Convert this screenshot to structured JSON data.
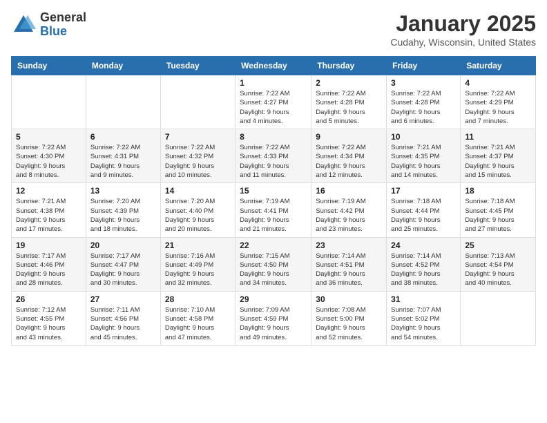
{
  "logo": {
    "general": "General",
    "blue": "Blue"
  },
  "title": "January 2025",
  "location": "Cudahy, Wisconsin, United States",
  "headers": [
    "Sunday",
    "Monday",
    "Tuesday",
    "Wednesday",
    "Thursday",
    "Friday",
    "Saturday"
  ],
  "weeks": [
    [
      {
        "day": "",
        "info": ""
      },
      {
        "day": "",
        "info": ""
      },
      {
        "day": "",
        "info": ""
      },
      {
        "day": "1",
        "info": "Sunrise: 7:22 AM\nSunset: 4:27 PM\nDaylight: 9 hours\nand 4 minutes."
      },
      {
        "day": "2",
        "info": "Sunrise: 7:22 AM\nSunset: 4:28 PM\nDaylight: 9 hours\nand 5 minutes."
      },
      {
        "day": "3",
        "info": "Sunrise: 7:22 AM\nSunset: 4:28 PM\nDaylight: 9 hours\nand 6 minutes."
      },
      {
        "day": "4",
        "info": "Sunrise: 7:22 AM\nSunset: 4:29 PM\nDaylight: 9 hours\nand 7 minutes."
      }
    ],
    [
      {
        "day": "5",
        "info": "Sunrise: 7:22 AM\nSunset: 4:30 PM\nDaylight: 9 hours\nand 8 minutes."
      },
      {
        "day": "6",
        "info": "Sunrise: 7:22 AM\nSunset: 4:31 PM\nDaylight: 9 hours\nand 9 minutes."
      },
      {
        "day": "7",
        "info": "Sunrise: 7:22 AM\nSunset: 4:32 PM\nDaylight: 9 hours\nand 10 minutes."
      },
      {
        "day": "8",
        "info": "Sunrise: 7:22 AM\nSunset: 4:33 PM\nDaylight: 9 hours\nand 11 minutes."
      },
      {
        "day": "9",
        "info": "Sunrise: 7:22 AM\nSunset: 4:34 PM\nDaylight: 9 hours\nand 12 minutes."
      },
      {
        "day": "10",
        "info": "Sunrise: 7:21 AM\nSunset: 4:35 PM\nDaylight: 9 hours\nand 14 minutes."
      },
      {
        "day": "11",
        "info": "Sunrise: 7:21 AM\nSunset: 4:37 PM\nDaylight: 9 hours\nand 15 minutes."
      }
    ],
    [
      {
        "day": "12",
        "info": "Sunrise: 7:21 AM\nSunset: 4:38 PM\nDaylight: 9 hours\nand 17 minutes."
      },
      {
        "day": "13",
        "info": "Sunrise: 7:20 AM\nSunset: 4:39 PM\nDaylight: 9 hours\nand 18 minutes."
      },
      {
        "day": "14",
        "info": "Sunrise: 7:20 AM\nSunset: 4:40 PM\nDaylight: 9 hours\nand 20 minutes."
      },
      {
        "day": "15",
        "info": "Sunrise: 7:19 AM\nSunset: 4:41 PM\nDaylight: 9 hours\nand 21 minutes."
      },
      {
        "day": "16",
        "info": "Sunrise: 7:19 AM\nSunset: 4:42 PM\nDaylight: 9 hours\nand 23 minutes."
      },
      {
        "day": "17",
        "info": "Sunrise: 7:18 AM\nSunset: 4:44 PM\nDaylight: 9 hours\nand 25 minutes."
      },
      {
        "day": "18",
        "info": "Sunrise: 7:18 AM\nSunset: 4:45 PM\nDaylight: 9 hours\nand 27 minutes."
      }
    ],
    [
      {
        "day": "19",
        "info": "Sunrise: 7:17 AM\nSunset: 4:46 PM\nDaylight: 9 hours\nand 28 minutes."
      },
      {
        "day": "20",
        "info": "Sunrise: 7:17 AM\nSunset: 4:47 PM\nDaylight: 9 hours\nand 30 minutes."
      },
      {
        "day": "21",
        "info": "Sunrise: 7:16 AM\nSunset: 4:49 PM\nDaylight: 9 hours\nand 32 minutes."
      },
      {
        "day": "22",
        "info": "Sunrise: 7:15 AM\nSunset: 4:50 PM\nDaylight: 9 hours\nand 34 minutes."
      },
      {
        "day": "23",
        "info": "Sunrise: 7:14 AM\nSunset: 4:51 PM\nDaylight: 9 hours\nand 36 minutes."
      },
      {
        "day": "24",
        "info": "Sunrise: 7:14 AM\nSunset: 4:52 PM\nDaylight: 9 hours\nand 38 minutes."
      },
      {
        "day": "25",
        "info": "Sunrise: 7:13 AM\nSunset: 4:54 PM\nDaylight: 9 hours\nand 40 minutes."
      }
    ],
    [
      {
        "day": "26",
        "info": "Sunrise: 7:12 AM\nSunset: 4:55 PM\nDaylight: 9 hours\nand 43 minutes."
      },
      {
        "day": "27",
        "info": "Sunrise: 7:11 AM\nSunset: 4:56 PM\nDaylight: 9 hours\nand 45 minutes."
      },
      {
        "day": "28",
        "info": "Sunrise: 7:10 AM\nSunset: 4:58 PM\nDaylight: 9 hours\nand 47 minutes."
      },
      {
        "day": "29",
        "info": "Sunrise: 7:09 AM\nSunset: 4:59 PM\nDaylight: 9 hours\nand 49 minutes."
      },
      {
        "day": "30",
        "info": "Sunrise: 7:08 AM\nSunset: 5:00 PM\nDaylight: 9 hours\nand 52 minutes."
      },
      {
        "day": "31",
        "info": "Sunrise: 7:07 AM\nSunset: 5:02 PM\nDaylight: 9 hours\nand 54 minutes."
      },
      {
        "day": "",
        "info": ""
      }
    ]
  ]
}
